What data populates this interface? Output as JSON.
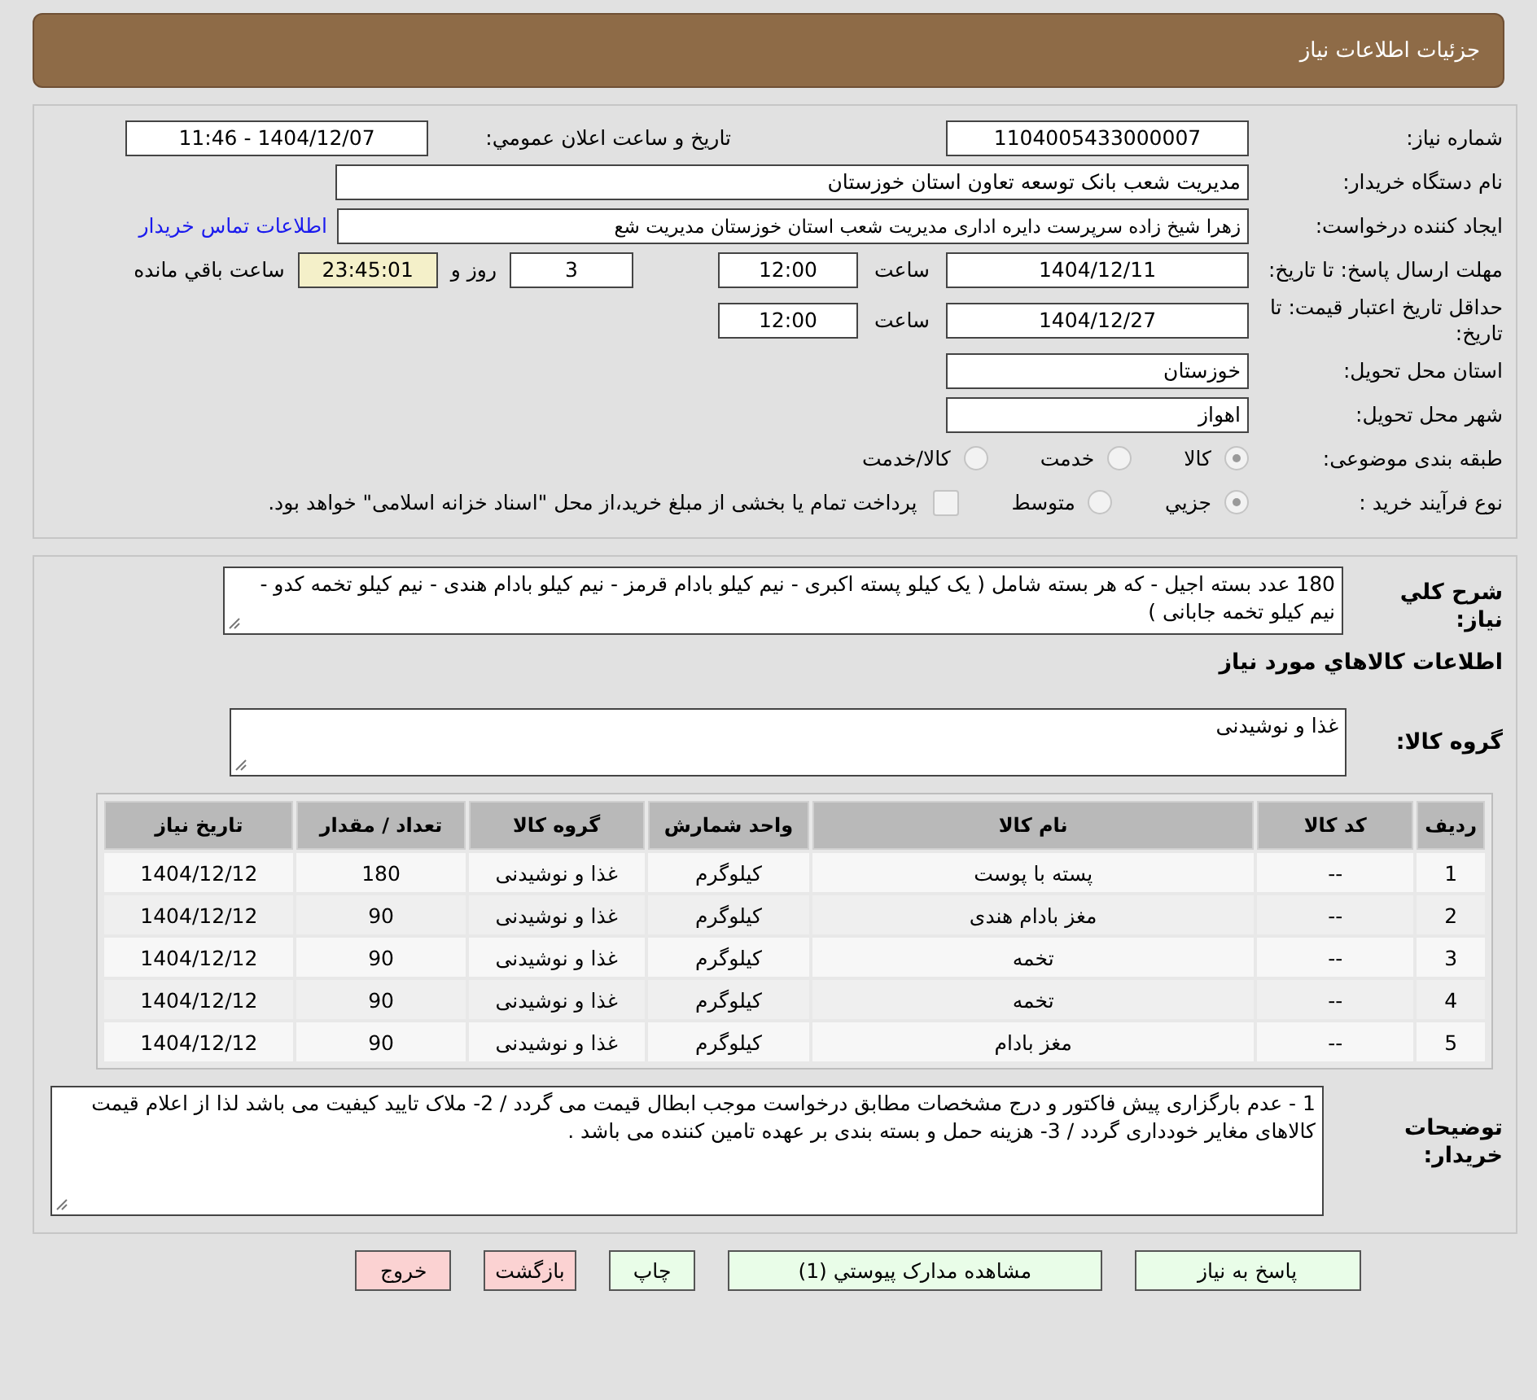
{
  "header": {
    "title": "جزئیات اطلاعات نیاز"
  },
  "need_number": {
    "label": "شماره نیاز:",
    "value": "1104005433000007"
  },
  "announce": {
    "label": "تاریخ و ساعت اعلان عمومي:",
    "value": "1404/12/07 - 11:46"
  },
  "buyer_org": {
    "label": "نام دستگاه خریدار:",
    "value": "مدیریت شعب بانک توسعه تعاون استان خوزستان"
  },
  "requester": {
    "label": "ایجاد کننده درخواست:",
    "value": "زهرا شیخ زاده سرپرست دایره اداری مدیریت شعب استان خوزستان مدیریت شع",
    "link": "اطلاعات تماس خریدار"
  },
  "deadline": {
    "label": "مهلت ارسال پاسخ: تا تاریخ:",
    "date": "1404/12/11",
    "time_label": "ساعت",
    "time": "12:00",
    "days": "3",
    "days_label": "روز و",
    "remaining": "23:45:01",
    "remaining_label": "ساعت باقي مانده"
  },
  "validity": {
    "label": "حداقل تاریخ اعتبار قیمت: تا تاریخ:",
    "date": "1404/12/27",
    "time_label": "ساعت",
    "time": "12:00"
  },
  "province": {
    "label": "استان محل تحویل:",
    "value": "خوزستان"
  },
  "city": {
    "label": "شهر محل تحویل:",
    "value": "اهواز"
  },
  "category": {
    "label": "طبقه بندی موضوعی:",
    "options": [
      {
        "label": "کالا",
        "selected": true
      },
      {
        "label": "خدمت",
        "selected": false
      },
      {
        "label": "کالا/خدمت",
        "selected": false
      }
    ]
  },
  "process": {
    "label": "نوع فرآیند خرید :",
    "options": [
      {
        "label": "جزيي",
        "selected": true
      },
      {
        "label": "متوسط",
        "selected": false
      }
    ],
    "treasury": {
      "checked": false,
      "text": "پرداخت تمام یا بخشی از مبلغ خرید،از محل \"اسناد خزانه اسلامی\" خواهد بود."
    }
  },
  "description": {
    "label": "شرح کلي نیاز:",
    "value": "180 عدد بسته اجیل - که هر بسته شامل ( یک کیلو پسته اکبری - نیم کیلو بادام قرمز - نیم کیلو بادام هندی - نیم کیلو تخمه کدو - نیم کیلو تخمه جابانی )"
  },
  "goods_section": {
    "title": "اطلاعات کالاهاي مورد نیاز"
  },
  "goods_group": {
    "label": "گروه کالا:",
    "value": "غذا و نوشیدنی"
  },
  "table": {
    "columns": [
      "ردیف",
      "کد کالا",
      "نام کالا",
      "واحد شمارش",
      "گروه کالا",
      "تعداد / مقدار",
      "تاریخ نیاز"
    ],
    "rows": [
      [
        "1",
        "--",
        "پسته با پوست",
        "کیلوگرم",
        "غذا و نوشیدنی",
        "180",
        "1404/12/12"
      ],
      [
        "2",
        "--",
        "مغز بادام هندی",
        "کیلوگرم",
        "غذا و نوشیدنی",
        "90",
        "1404/12/12"
      ],
      [
        "3",
        "--",
        "تخمه",
        "کیلوگرم",
        "غذا و نوشیدنی",
        "90",
        "1404/12/12"
      ],
      [
        "4",
        "--",
        "تخمه",
        "کیلوگرم",
        "غذا و نوشیدنی",
        "90",
        "1404/12/12"
      ],
      [
        "5",
        "--",
        "مغز بادام",
        "کیلوگرم",
        "غذا و نوشیدنی",
        "90",
        "1404/12/12"
      ]
    ]
  },
  "buyer_notes": {
    "label": "توضیحات خریدار:",
    "value": "1 - عدم بارگزاری پیش فاکتور و درج مشخصات مطابق درخواست موجب ابطال قیمت می گردد / 2- ملاک تایید کیفیت می باشد لذا از اعلام قیمت کالاهای مغایر خودداری گردد / 3- هزینه حمل و بسته بندی بر عهده تامین کننده می باشد ."
  },
  "buttons": [
    {
      "label": "پاسخ به نیاز",
      "kind": "primary"
    },
    {
      "label": "مشاهده مدارک پیوستي (1)",
      "kind": "primary"
    },
    {
      "label": "چاپ",
      "kind": "primary"
    },
    {
      "label": "بازگشت",
      "kind": "danger"
    },
    {
      "label": "خروج",
      "kind": "danger"
    }
  ]
}
